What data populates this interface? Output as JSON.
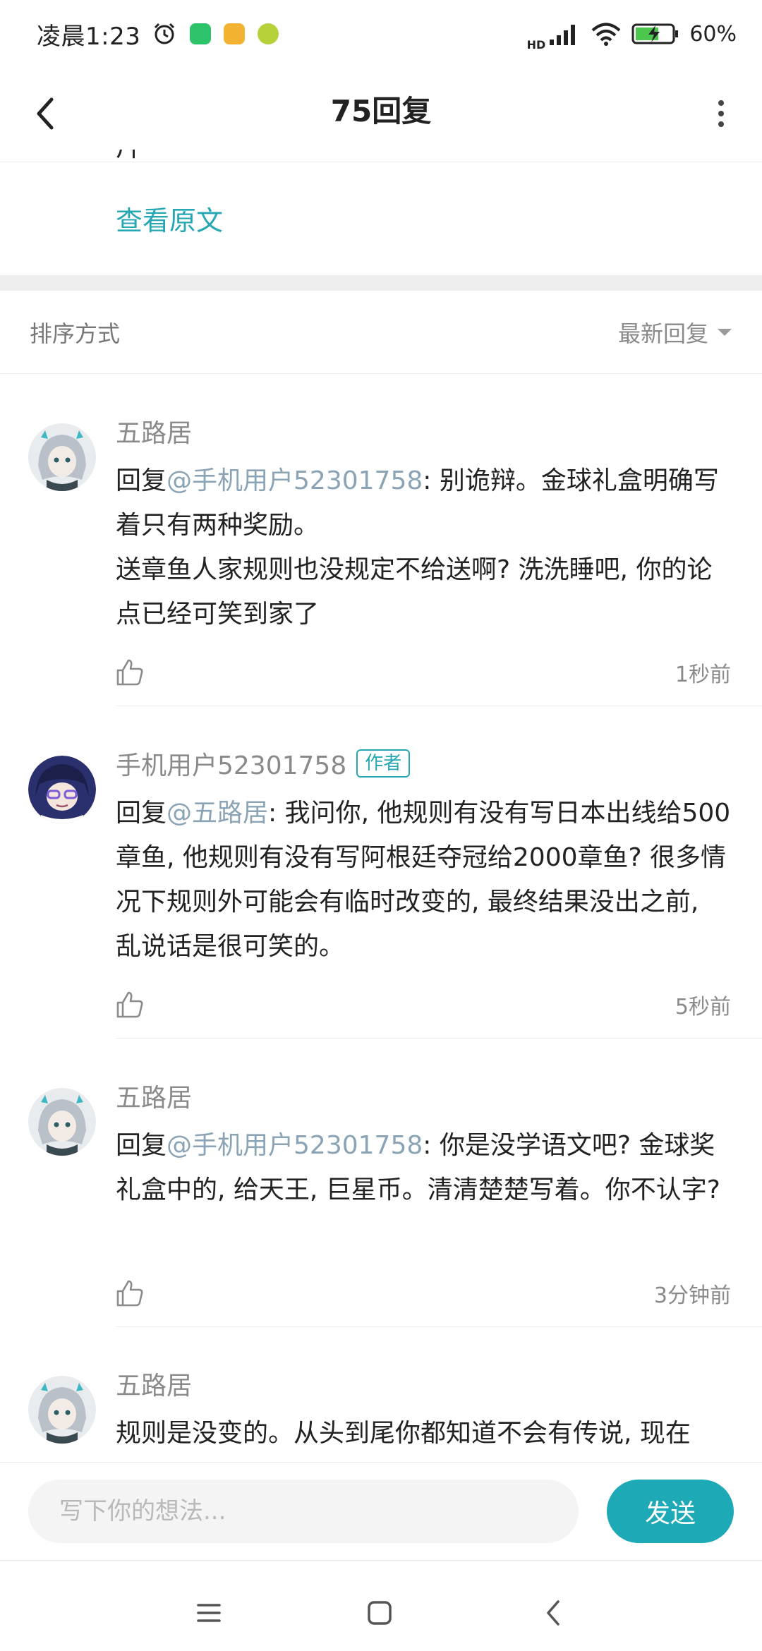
{
  "status_bar": {
    "time": "凌晨1:23",
    "battery_percent": "60%",
    "network": "HD"
  },
  "header": {
    "title": "75回复"
  },
  "post_tail": {
    "cut_text": "片",
    "view_original_label": "查看原文"
  },
  "sort": {
    "label": "排序方式",
    "selected": "最新回复"
  },
  "comments": [
    {
      "user": "五路居",
      "is_author": false,
      "reply_prefix": "回复",
      "mention": "@手机用户52301758",
      "text_line1": ": 别诡辩。金球礼盒明确写着只有两种奖励。",
      "text_line2": "送章鱼人家规则也没规定不给送啊? 洗洗睡吧, 你的论点已经可笑到家了",
      "time": "1秒前"
    },
    {
      "user": "手机用户52301758",
      "is_author": true,
      "author_badge": "作者",
      "reply_prefix": "回复",
      "mention": "@五路居",
      "text_line1": ": 我问你, 他规则有没有写日本出线给500章鱼, 他规则有没有写阿根廷夺冠给2000章鱼? 很多情况下规则外可能会有临时改变的, 最终结果没出之前, 乱说话是很可笑的。",
      "time": "5秒前"
    },
    {
      "user": "五路居",
      "is_author": false,
      "reply_prefix": "回复",
      "mention": "@手机用户52301758",
      "text_line1": ": 你是没学语文吧? 金球奖礼盒中的, 给天王, 巨星币。清清楚楚写着。你不认字?",
      "time": "3分钟前"
    },
    {
      "user": "五路居",
      "is_author": false,
      "text_line1": "规则是没变的。从头到尾你都知道不会有传说, 现在"
    }
  ],
  "composer": {
    "placeholder": "写下你的想法...",
    "send_label": "发送"
  },
  "colors": {
    "accent": "#26a7b4",
    "send_button": "#1ea9b6",
    "mention": "#8aa4b5"
  }
}
